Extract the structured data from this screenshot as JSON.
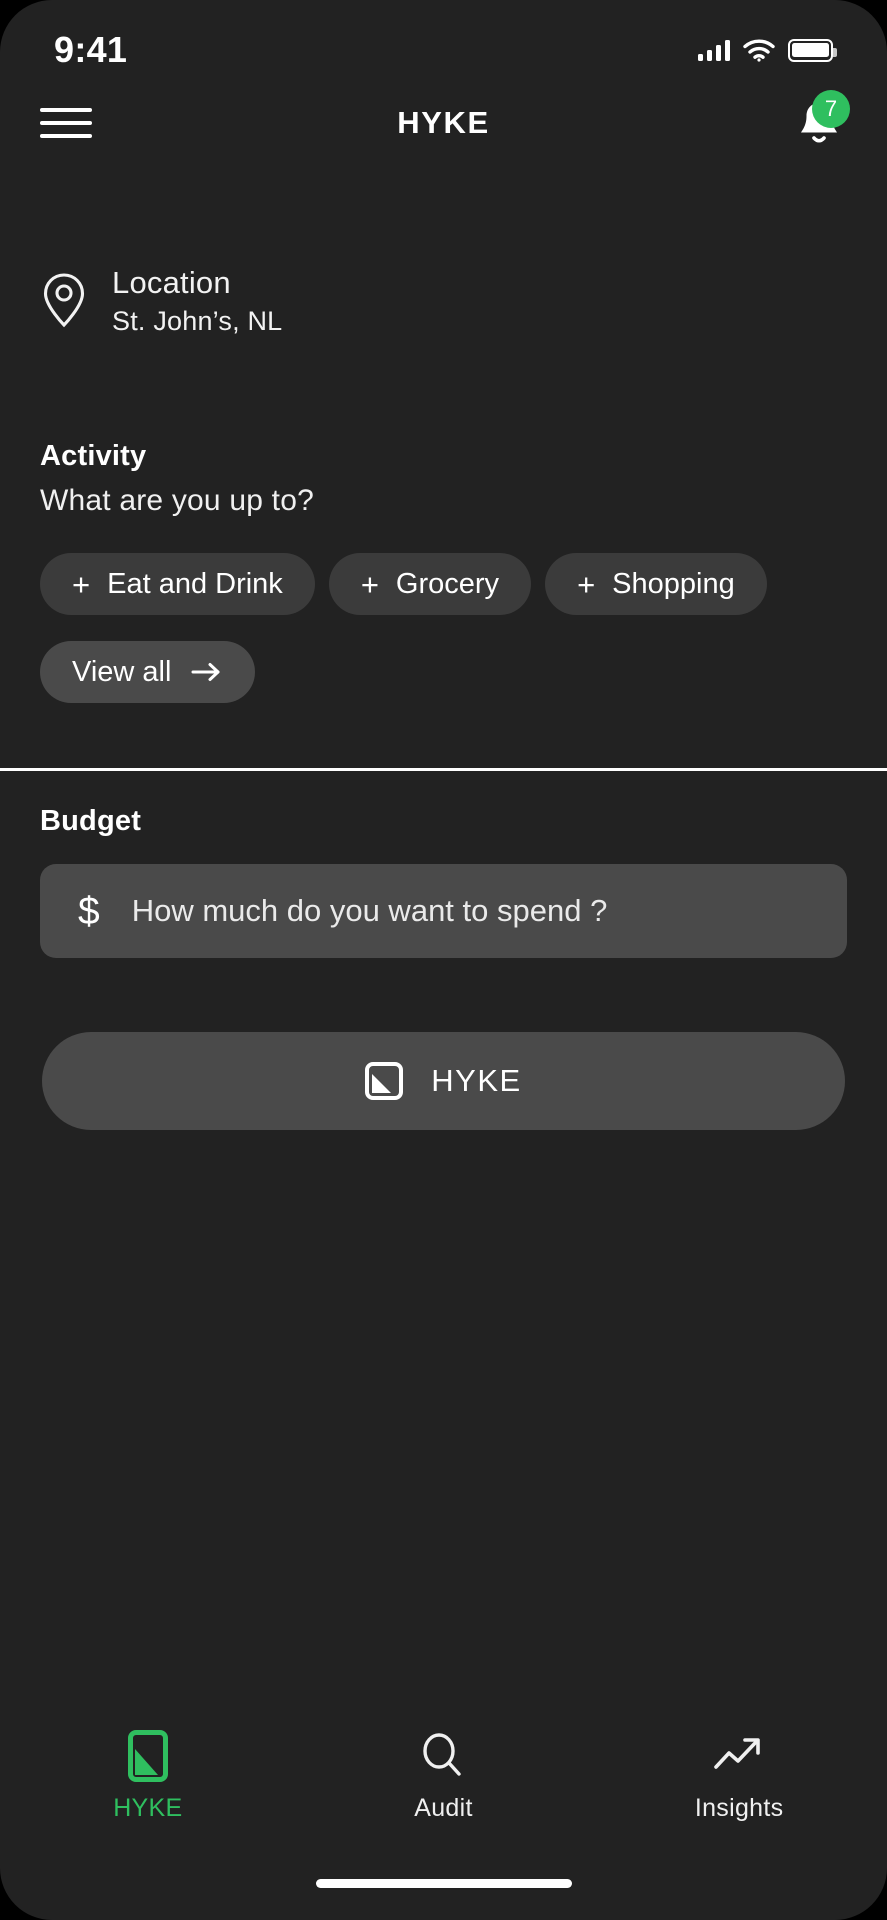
{
  "status_bar": {
    "time": "9:41",
    "signal_icon": "cellular-signal-icon",
    "wifi_icon": "wifi-icon",
    "battery_icon": "battery-full-icon"
  },
  "header": {
    "menu_icon": "hamburger-menu-icon",
    "title": "HYKE",
    "notification_icon": "bell-icon",
    "notification_count": "7",
    "badge_color": "#2fbf5f"
  },
  "location": {
    "pin_icon": "location-pin-icon",
    "label": "Location",
    "value": "St. John’s, NL"
  },
  "activity": {
    "title": "Activity",
    "subtitle": "What are you up to?",
    "chips": [
      {
        "plus": "+",
        "label": "Eat and Drink"
      },
      {
        "plus": "+",
        "label": "Grocery"
      },
      {
        "plus": "+",
        "label": "Shopping"
      }
    ],
    "view_all": {
      "label": "View all",
      "arrow_icon": "arrow-right-icon"
    }
  },
  "budget": {
    "title": "Budget",
    "currency_symbol": "$",
    "input_value": "",
    "placeholder": "How much do you want to spend ?"
  },
  "primary_action": {
    "icon": "hyke-square-icon",
    "label": "HYKE"
  },
  "bottom_nav": {
    "active_color": "#2fbf5f",
    "items": [
      {
        "icon": "hyke-square-icon",
        "label": "HYKE",
        "active": true
      },
      {
        "icon": "search-icon",
        "label": "Audit",
        "active": false
      },
      {
        "icon": "trending-up-icon",
        "label": "Insights",
        "active": false
      }
    ]
  }
}
